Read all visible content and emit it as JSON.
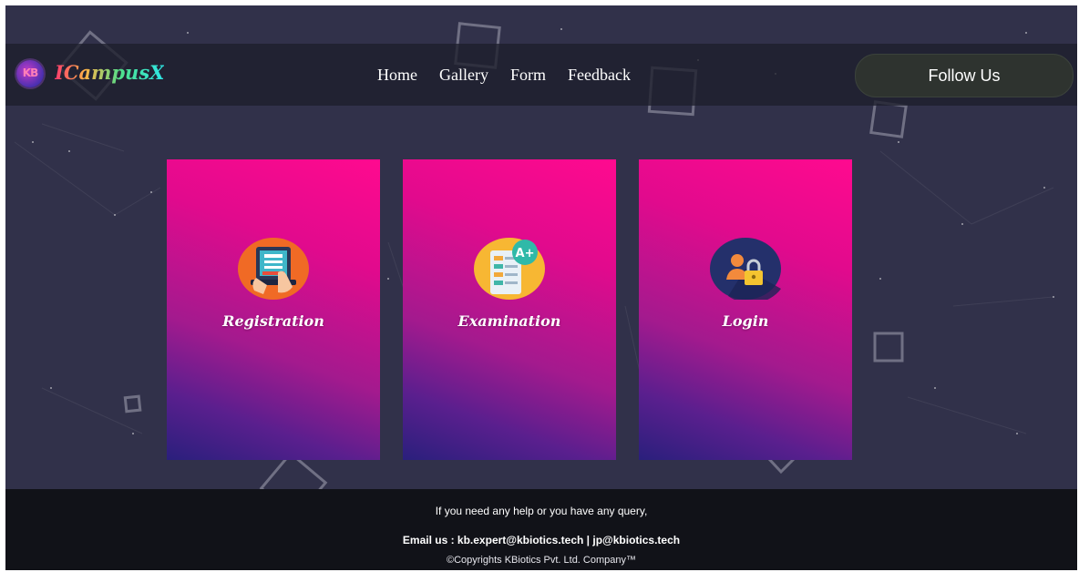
{
  "brand": {
    "logo_text": "KB",
    "name": "ICampusX"
  },
  "nav": {
    "items": [
      {
        "label": "Home",
        "name": "nav-home"
      },
      {
        "label": "Gallery",
        "name": "nav-gallery"
      },
      {
        "label": "Form",
        "name": "nav-form"
      },
      {
        "label": "Feedback",
        "name": "nav-feedback"
      }
    ],
    "follow_label": "Follow Us"
  },
  "cards": [
    {
      "label": "Registration",
      "icon": "registration-icon"
    },
    {
      "label": "Examination",
      "icon": "examination-icon"
    },
    {
      "label": "Login",
      "icon": "login-lock-icon"
    }
  ],
  "footer": {
    "help_text": "If you need any help or you have any query,",
    "email_text": "Email us : kb.expert@kbiotics.tech | jp@kbiotics.tech",
    "copyright": "©Copyrights KBiotics Pvt. Ltd. Company™"
  },
  "colors": {
    "background": "#31314a",
    "navbar": "#1e1f2c",
    "card_top": "#ff0a8f",
    "card_bottom": "#2a1f7c",
    "footer": "#111218",
    "follow_button": "#2e332f"
  }
}
